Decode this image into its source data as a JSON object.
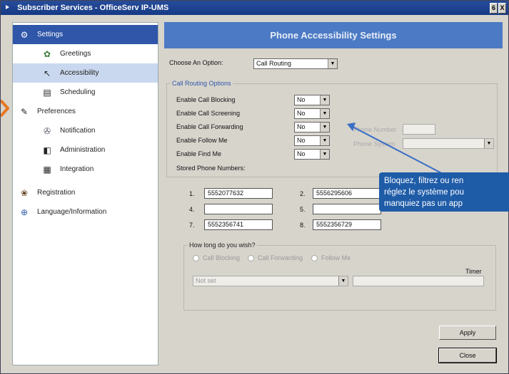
{
  "window": {
    "title": "Subscriber Services - OfficeServ IP-UMS",
    "controls": [
      "6",
      "X"
    ]
  },
  "sidebar": {
    "items": [
      {
        "label": "Settings",
        "icon": "settings-icon",
        "glyph": "⚙"
      },
      {
        "label": "Greetings",
        "icon": "greetings-icon",
        "glyph": "✿"
      },
      {
        "label": "Accessibility",
        "icon": "accessibility-icon",
        "glyph": "↖"
      },
      {
        "label": "Scheduling",
        "icon": "calendar-icon",
        "glyph": "▤"
      },
      {
        "label": "Preferences",
        "icon": "preferences-icon",
        "glyph": "✎"
      },
      {
        "label": "Notification",
        "icon": "notification-icon",
        "glyph": "✇"
      },
      {
        "label": "Administration",
        "icon": "administration-icon",
        "glyph": "◧"
      },
      {
        "label": "Integration",
        "icon": "integration-icon",
        "glyph": "▦"
      },
      {
        "label": "Registration",
        "icon": "registration-icon",
        "glyph": "❀"
      },
      {
        "label": "Language/Information",
        "icon": "globe-icon",
        "glyph": "⊕"
      }
    ]
  },
  "header": {
    "title": "Phone Accessibility Settings"
  },
  "option": {
    "label": "Choose An Option:",
    "value": "Call Routing"
  },
  "routing": {
    "group_title": "Call Routing Options",
    "rows": [
      {
        "label": "Enable Call Blocking",
        "value": "No"
      },
      {
        "label": "Enable Call Screening",
        "value": "No"
      },
      {
        "label": "Enable Call Forwarding",
        "value": "No"
      },
      {
        "label": "Enable Follow Me",
        "value": "No"
      },
      {
        "label": "Enable Find Me",
        "value": "No"
      }
    ],
    "phone_number_label": "Phone Number",
    "phone_number_value": "",
    "phone_system_label": "Phone System",
    "phone_system_value": "",
    "stored_label": "Stored Phone Numbers:",
    "stored": [
      {
        "num": "1.",
        "value": "5552077632"
      },
      {
        "num": "2.",
        "value": "5556295606"
      },
      {
        "num": "4.",
        "value": ""
      },
      {
        "num": "5.",
        "value": ""
      },
      {
        "num": "7.",
        "value": "5552356741"
      },
      {
        "num": "8.",
        "value": "5552356729"
      }
    ]
  },
  "duration": {
    "group_title": "How long do you wish?",
    "radios": [
      "Call Blocking",
      "Call Forwarding",
      "Follow Me"
    ],
    "timer_label": "Timer",
    "select_value": "Not set",
    "timer_value": ""
  },
  "buttons": {
    "apply": "Apply",
    "close": "Close"
  },
  "tooltip": {
    "lines": [
      "Bloquez, filtrez ou ren",
      "réglez le système pou",
      "manquiez pas un app"
    ]
  },
  "colors": {
    "header": "#4c7ac4",
    "selected": "#2f56a8",
    "tooltip": "#1f5ca8",
    "arrow": "#3b6fc4",
    "accent": "#e87722"
  }
}
